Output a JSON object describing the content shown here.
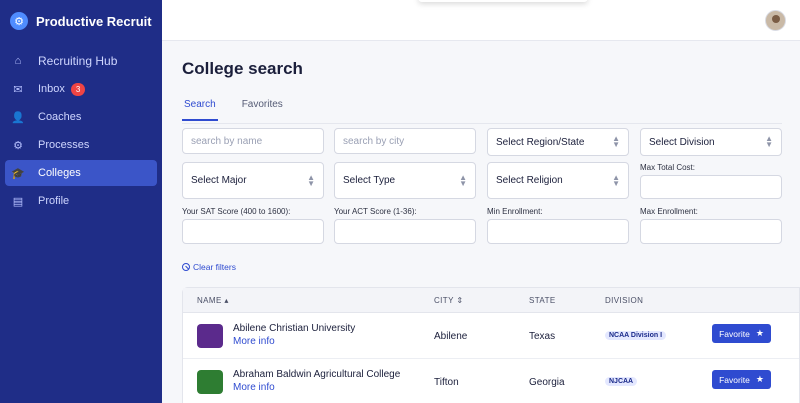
{
  "app": {
    "name": "Productive Recruit",
    "logo_glyph": "⚙"
  },
  "sidebar": {
    "items": [
      {
        "label": "Recruiting Hub",
        "icon": "home-icon",
        "glyph": "⌂"
      },
      {
        "label": "Inbox",
        "icon": "inbox-icon",
        "glyph": "✉",
        "badge": "3"
      },
      {
        "label": "Coaches",
        "icon": "user-icon",
        "glyph": "👤"
      },
      {
        "label": "Processes",
        "icon": "gear-icon",
        "glyph": "⚙"
      },
      {
        "label": "Colleges",
        "icon": "graduation-cap-icon",
        "glyph": "🎓"
      },
      {
        "label": "Profile",
        "icon": "clipboard-icon",
        "glyph": "▤"
      }
    ],
    "active_index": 4
  },
  "page": {
    "title": "College search"
  },
  "tabs": [
    {
      "label": "Search"
    },
    {
      "label": "Favorites"
    }
  ],
  "filters": {
    "name_placeholder": "search by name",
    "city_placeholder": "search by city",
    "region": "Select Region/State",
    "division": "Select Division",
    "major": "Select Major",
    "type": "Select Type",
    "religion": "Select Religion",
    "max_cost_label": "Max Total Cost:",
    "sat_label": "Your SAT Score (400 to 1600):",
    "act_label": "Your ACT Score (1-36):",
    "min_enroll_label": "Min Enrollment:",
    "max_enroll_label": "Max Enrollment:",
    "clear": "Clear filters"
  },
  "table": {
    "headers": {
      "name": "NAME",
      "city": "CITY",
      "state": "STATE",
      "division": "DIVISION"
    },
    "rows": [
      {
        "name": "Abilene Christian University",
        "more": "More info",
        "city": "Abilene",
        "state": "Texas",
        "division": "NCAA Division I",
        "favorite": "Favorite"
      },
      {
        "name": "Abraham Baldwin Agricultural College",
        "more": "More info",
        "city": "Tifton",
        "state": "Georgia",
        "division": "NJCAA",
        "favorite": "Favorite"
      }
    ]
  },
  "colors": {
    "sidebar": "#1f2d87",
    "accent": "#2f4bd0",
    "badge": "#ef4444"
  }
}
